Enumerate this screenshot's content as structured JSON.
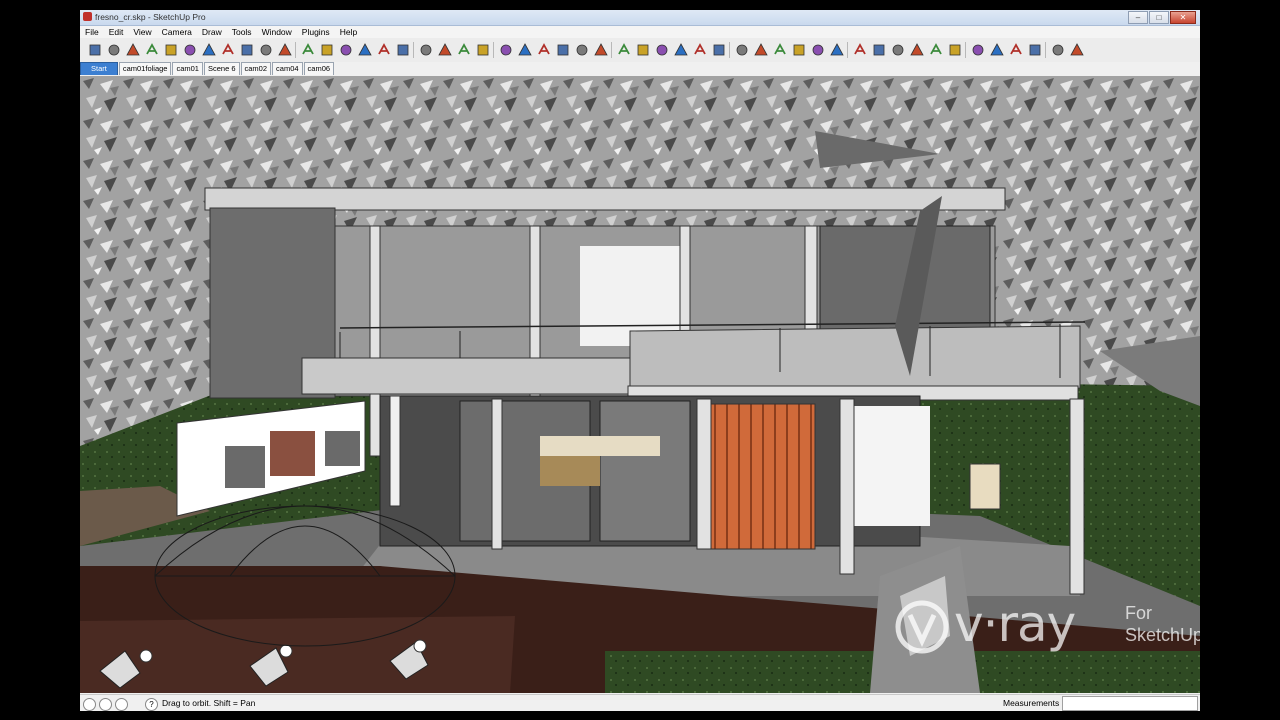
{
  "window": {
    "title": "fresno_cr.skp - SketchUp Pro"
  },
  "window_controls": {
    "minimize": "–",
    "maximize": "□",
    "close": "✕"
  },
  "menu": [
    "File",
    "Edit",
    "View",
    "Camera",
    "Draw",
    "Tools",
    "Window",
    "Plugins",
    "Help"
  ],
  "toolbar_icons": [
    "new-icon",
    "open-icon",
    "save-icon",
    "cut-icon",
    "copy-icon",
    "paste-icon",
    "erase-icon",
    "undo-icon",
    "redo-icon",
    "print-icon",
    "model-info-icon",
    "component-icon",
    "house-front-icon",
    "house-side-icon",
    "house-top-icon",
    "house-iso-icon",
    "section-icon",
    "select-arrow-icon",
    "component-box-icon",
    "paint-bucket-icon",
    "eraser-icon",
    "rectangle-icon",
    "pencil-icon",
    "circle-icon",
    "arc-icon",
    "polygon-icon",
    "freehand-icon",
    "move-icon",
    "push-pull-icon",
    "rotate-icon",
    "follow-me-icon",
    "scale-icon",
    "offset-icon",
    "tape-measure-icon",
    "dimension-icon",
    "protractor-icon",
    "text-icon",
    "axes-icon",
    "3d-text-icon",
    "orbit-icon",
    "pan-icon",
    "zoom-icon",
    "zoom-window-icon",
    "zoom-extents-icon",
    "previous-view-icon",
    "position-camera-icon",
    "look-around-icon",
    "walk-icon",
    "section-plane-icon",
    "vray-render-icon",
    "vray-material-icon"
  ],
  "scene_tabs": [
    "Start",
    "cam01foliage",
    "cam01",
    "Scene 6",
    "cam02",
    "cam04",
    "cam06"
  ],
  "active_scene": "Start",
  "watermark": {
    "brand": "v·ray",
    "for": "For",
    "product": "SketchUp"
  },
  "statusbar": {
    "hint": "Drag to orbit.  Shift = Pan",
    "measurements_label": "Measurements",
    "measurements_value": "",
    "help_icon": "?"
  },
  "colors": {
    "door": "#d06a3a",
    "grass": "#2f4a23",
    "deck": "#3a1f18",
    "active_tab": "#3c7fd1"
  }
}
